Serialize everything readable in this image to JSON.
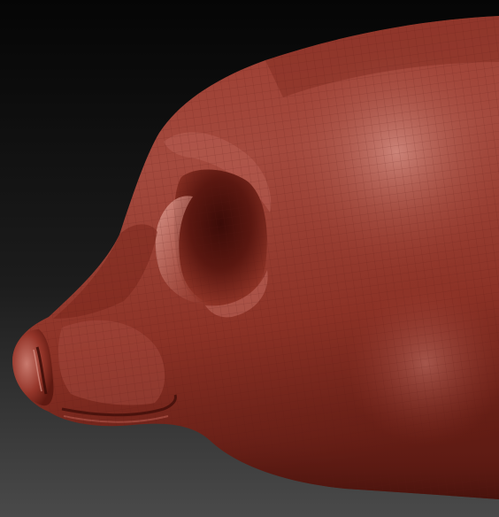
{
  "viewport": {
    "background_top": "#050505",
    "background_bottom": "#4a4a4a"
  },
  "model": {
    "material": "red-wax-clay",
    "base_color": "#8f3227",
    "highlight_color": "#c47d72",
    "shadow_color": "#4a120d",
    "wireframe_color": "#5a1a14",
    "wireframe_visible": true
  }
}
